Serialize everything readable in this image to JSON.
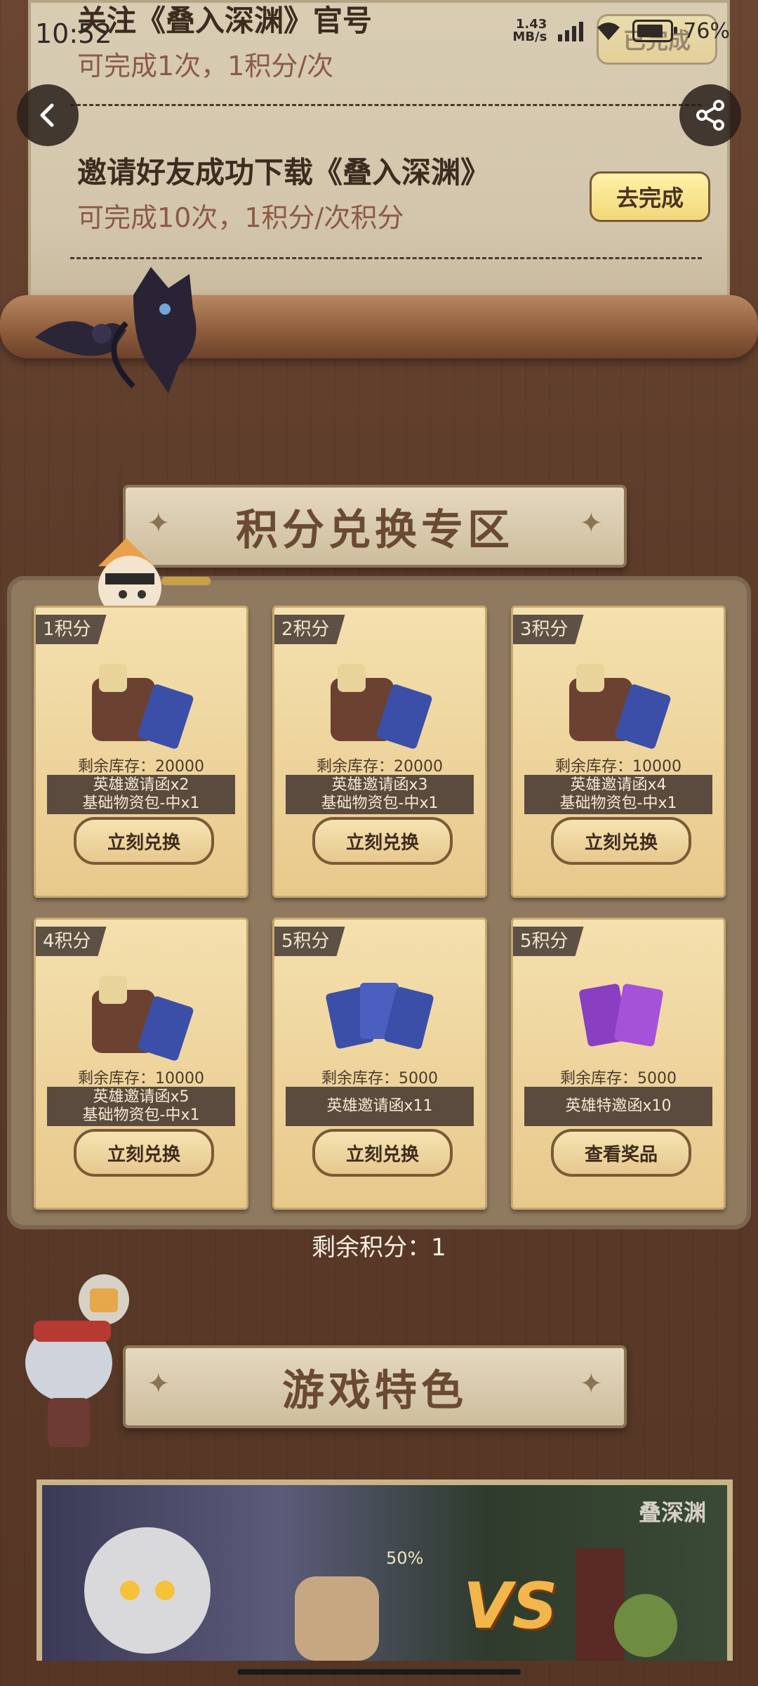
{
  "status_bar": {
    "time": "10:52",
    "speed_value": "1.43",
    "speed_unit": "MB/s",
    "battery": "76%"
  },
  "tasks": [
    {
      "title": "关注《叠入深渊》官号",
      "subtitle": "可完成1次，1积分/次",
      "button": "已完成"
    },
    {
      "title": "邀请好友成功下载《叠入深渊》",
      "subtitle": "可完成10次，1积分/次积分",
      "button": "去完成"
    }
  ],
  "sections": {
    "exchange_title": "积分兑换专区",
    "features_title": "游戏特色"
  },
  "exchange_items": [
    {
      "points": "1积分",
      "stock": "剩余库存：20000",
      "line1": "英雄邀请函x2",
      "line2": "基础物资包-中x1",
      "button": "立刻兑换"
    },
    {
      "points": "2积分",
      "stock": "剩余库存：20000",
      "line1": "英雄邀请函x3",
      "line2": "基础物资包-中x1",
      "button": "立刻兑换"
    },
    {
      "points": "3积分",
      "stock": "剩余库存：10000",
      "line1": "英雄邀请函x4",
      "line2": "基础物资包-中x1",
      "button": "立刻兑换"
    },
    {
      "points": "4积分",
      "stock": "剩余库存：10000",
      "line1": "英雄邀请函x5",
      "line2": "基础物资包-中x1",
      "button": "立刻兑换"
    },
    {
      "points": "5积分",
      "stock": "剩余库存：5000",
      "line1": "英雄邀请函x11",
      "line2": "",
      "button": "立刻兑换"
    },
    {
      "points": "5积分",
      "stock": "剩余库存：5000",
      "line1": "英雄特邀函x10",
      "line2": "",
      "button": "查看奖品"
    }
  ],
  "remaining_points": "剩余积分：1",
  "feature_image": {
    "badge": "50%",
    "vs_text": "VS",
    "logo_text": "叠深渊"
  },
  "icons": {
    "back": "back-arrow-icon",
    "share": "share-icon"
  }
}
